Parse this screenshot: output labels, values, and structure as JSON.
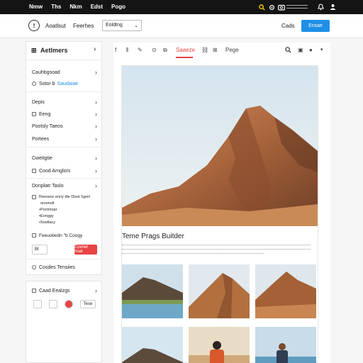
{
  "topbar": {
    "nav": [
      "Nmw",
      "Ths",
      "Nkm",
      "Edst",
      "Pogo"
    ],
    "icons": [
      "search-icon",
      "camera-icon",
      "settings-icon",
      "notification-icon",
      "user-icon"
    ]
  },
  "toolbar": {
    "items": [
      "Aoatlsut",
      "Feerhes"
    ],
    "dropdown_value": "Eoldtng",
    "cancel_label": "Cads",
    "primary_label": "Ensae"
  },
  "sidebar": {
    "title": "Aetlmers",
    "s1_label": "Cauhbgsoad",
    "s1_check_label": "Sotor b",
    "s1_link": "Saudaiae",
    "s2_items": [
      "Depis",
      "Eeng",
      "Pootsly Taeos",
      "Portees"
    ],
    "s3_items": [
      "Cweitgtie",
      "Cood Arnglors"
    ],
    "s4_label": "Donplatr Taslo",
    "s4_check_label": "Reessoc enny dle Disst Sgrel",
    "s4_sub": "oroonsll",
    "s4_bullets": [
      "Poctmopr",
      "Eonggy",
      "Sootlacy"
    ],
    "s4_check2": "Feeuobedn \"b Coogy",
    "s4_input": "Bt",
    "s4_red_button": "Covnel hoat",
    "s5_label": "Cosdes Tensiies",
    "s6_label": "Caad Eealzgs",
    "s6_red_button": "Tese"
  },
  "editor": {
    "tabs": [
      "Saaeze",
      "Pege"
    ],
    "page_title": "Teme Prags Buitder"
  },
  "colors": {
    "accent_blue": "#1f8fe6",
    "accent_red": "#e84343"
  }
}
